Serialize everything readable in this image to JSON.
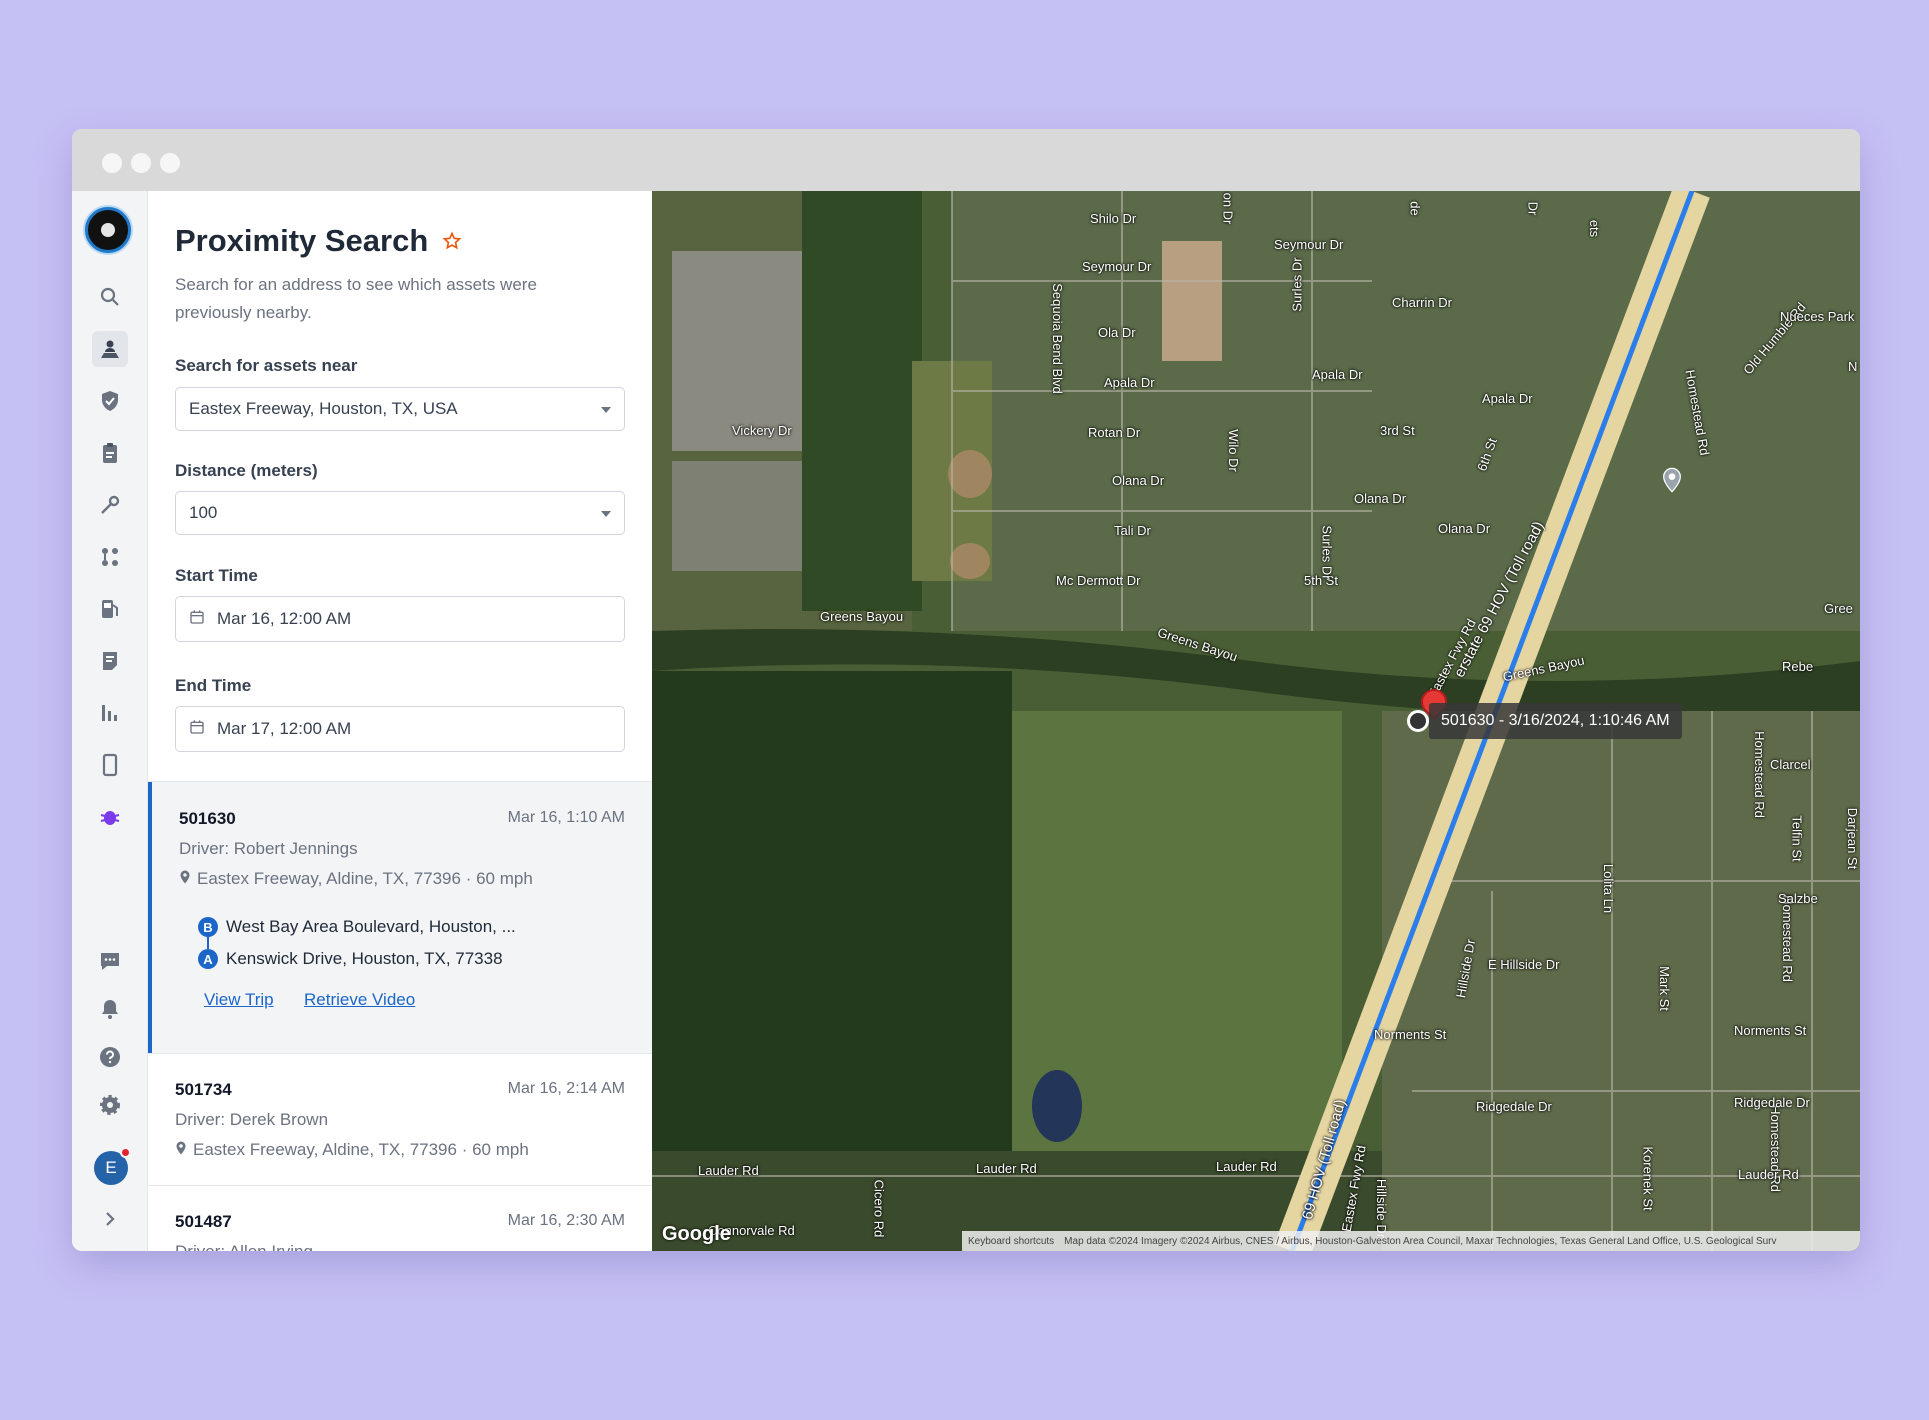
{
  "panel": {
    "title": "Proximity Search",
    "subtitle": "Search for an address to see which assets were previously nearby.",
    "search_label": "Search for assets near",
    "search_value": "Eastex Freeway, Houston, TX, USA",
    "distance_label": "Distance (meters)",
    "distance_value": "100",
    "start_label": "Start Time",
    "start_value": "Mar 16, 12:00 AM",
    "end_label": "End Time",
    "end_value": "Mar 17, 12:00 AM"
  },
  "results": [
    {
      "id": "501630",
      "time": "Mar 16, 1:10 AM",
      "driver": "Driver:  Robert Jennings",
      "location": "Eastex Freeway, Aldine, TX, 77396 · 60 mph",
      "stop_b_letter": "B",
      "stop_b": "West Bay Area Boulevard, Houston, ...",
      "stop_a_letter": "A",
      "stop_a": "Kenswick Drive, Houston, TX, 77338",
      "view_trip": "View Trip",
      "retrieve_video": "Retrieve Video"
    },
    {
      "id": "501734",
      "time": "Mar 16, 2:14 AM",
      "driver": "Driver:  Derek Brown",
      "location": "Eastex Freeway, Aldine, TX, 77396 · 60 mph"
    },
    {
      "id": "501487",
      "time": "Mar 16, 2:30 AM",
      "driver": "Driver:  Allen Irving"
    }
  ],
  "avatar_initial": "E",
  "map": {
    "tooltip": "501630 - 3/16/2024, 1:10:46 AM",
    "google": "Google",
    "keyboard_shortcuts": "Keyboard shortcuts",
    "attribution": "Map data ©2024 Imagery ©2024 Airbus, CNES / Airbus, Houston-Galveston Area Council, Maxar Technologies, Texas General Land Office, U.S. Geological Surv",
    "labels": {
      "shilo": "Shilo Dr",
      "seymour": "Seymour Dr",
      "seymour2": "Seymour Dr",
      "ola": "Ola Dr",
      "apala": "Apala Dr",
      "apala2": "Apala Dr",
      "apala3": "Apala Dr",
      "rotan": "Rotan Dr",
      "olana": "Olana Dr",
      "olana2": "Olana Dr",
      "olana3": "Olana Dr",
      "tali": "Tali Dr",
      "mcdermott": "Mc Dermott Dr",
      "vickery": "Vickery Dr",
      "charrin": "Charrin Dr",
      "third": "3rd St",
      "fifth": "5th St",
      "sixth": "6th St",
      "wilo": "Wilo Dr",
      "sequoia": "Sequoia Bend Blvd",
      "surles": "Surles Dr",
      "surles2": "Surles Dr",
      "greens1": "Greens Bayou",
      "greens2": "Greens Bayou",
      "greens3": "Greens Bayou",
      "greens4": "Gree",
      "hwy": "erstate 69 HOV (Toll road)",
      "hwy2": "69 HOV (Toll road)",
      "eastexfwy": "Eastex Fwy Rd",
      "eastexfwy2": "Eastex Fwy Rd",
      "oldhumble": "Old Humble Rd",
      "nueces": "Nueces Park",
      "homestead": "Homestead Rd",
      "homestead2": "Homestead Rd",
      "homestead3": "Homestead Rd",
      "homestead4": "Homestead Rd",
      "rebe": "Rebe",
      "clarcel": "Clarcel",
      "salzbe": "Salzbe",
      "telfin": "Telfin St",
      "darjean": "Darjean St",
      "lolita": "Lolita Ln",
      "hillside": "Hillside Dr",
      "ehillside": "E Hillside Dr",
      "hillside2": "Hillside Dr",
      "mark": "Mark St",
      "norments": "Norments St",
      "norments2": "Norments St",
      "ridgedale": "Ridgedale Dr",
      "ridgedale2": "Ridgedale Dr",
      "lauder1": "Lauder Rd",
      "lauder2": "Lauder Rd",
      "lauder3": "Lauder Rd",
      "lauder4": "Lauder Rd",
      "conorvale": "Connorvale Rd",
      "cicero": "Cicero Rd",
      "korenek": "Korenek St",
      "n": "N",
      "on": "on Dr",
      "de": "de",
      "dr": "Dr",
      "sts": "ets"
    }
  }
}
